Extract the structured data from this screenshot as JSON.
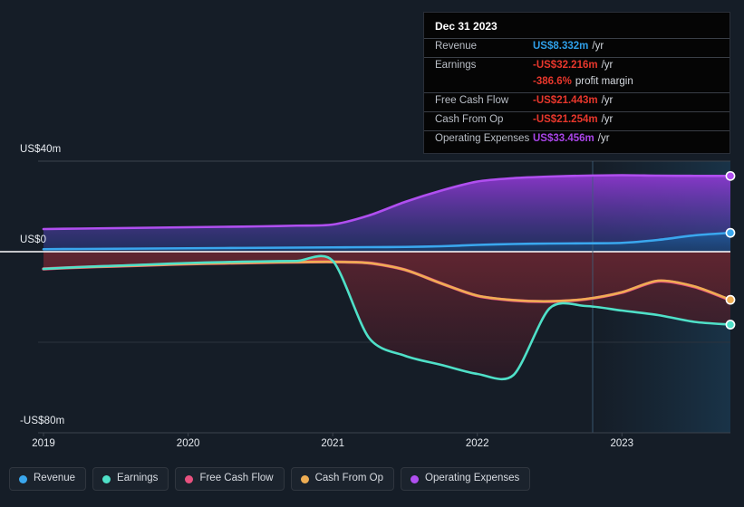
{
  "axes": {
    "y_labels": [
      "US$40m",
      "US$0",
      "-US$80m"
    ],
    "y_top_value": 40,
    "y_zero_value": 0,
    "y_bottom_value": -80,
    "x_labels": [
      "2019",
      "2020",
      "2021",
      "2022",
      "2023"
    ]
  },
  "tooltip": {
    "date": "Dec 31 2023",
    "rows": [
      {
        "label": "Revenue",
        "value": "US$8.332m",
        "unit": "/yr",
        "color_key": "blue"
      },
      {
        "label": "Earnings",
        "value": "-US$32.216m",
        "unit": "/yr",
        "color_key": "red"
      },
      {
        "label": "",
        "value": "-386.6%",
        "unit": "profit margin",
        "color_key": "red"
      },
      {
        "label": "Free Cash Flow",
        "value": "-US$21.443m",
        "unit": "/yr",
        "color_key": "red"
      },
      {
        "label": "Cash From Op",
        "value": "-US$21.254m",
        "unit": "/yr",
        "color_key": "red"
      },
      {
        "label": "Operating Expenses",
        "value": "US$33.456m",
        "unit": "/yr",
        "color_key": "purple"
      }
    ]
  },
  "legend": {
    "items": [
      {
        "label": "Revenue",
        "color": "#3aa7ee"
      },
      {
        "label": "Earnings",
        "color": "#4fe0c8"
      },
      {
        "label": "Free Cash Flow",
        "color": "#e8517f"
      },
      {
        "label": "Cash From Op",
        "color": "#eead53"
      },
      {
        "label": "Operating Expenses",
        "color": "#b04ff0"
      }
    ]
  },
  "colors": {
    "background": "#151d27",
    "zero_line": "#ffffff",
    "gridline": "#3c434d",
    "forecast_divider": "#3d5f7a",
    "positive_fill_top": "#b04ff0",
    "negative_fill": "#b33a3a"
  },
  "chart_data": {
    "type": "area",
    "title": "",
    "xlabel": "",
    "ylabel": "",
    "ylim": [
      -80,
      40
    ],
    "xlim": [
      "2019",
      "2023.75"
    ],
    "grid": true,
    "legend_position": "bottom",
    "annotation": "Vertical divider at 2023 separates reported from extrapolated period",
    "x": [
      2019.0,
      2019.25,
      2019.5,
      2019.75,
      2020.0,
      2020.25,
      2020.5,
      2020.75,
      2021.0,
      2021.25,
      2021.5,
      2021.75,
      2022.0,
      2022.25,
      2022.5,
      2022.75,
      2023.0,
      2023.25,
      2023.5,
      2023.75
    ],
    "series": [
      {
        "name": "Revenue",
        "color": "#3aa7ee",
        "values": [
          1.1,
          1.2,
          1.3,
          1.4,
          1.5,
          1.6,
          1.7,
          1.8,
          1.9,
          2.0,
          2.1,
          2.4,
          3.0,
          3.4,
          3.6,
          3.7,
          3.9,
          5.2,
          7.2,
          8.332
        ]
      },
      {
        "name": "Earnings",
        "color": "#4fe0c8",
        "values": [
          -7.6,
          -6.8,
          -6.2,
          -5.6,
          -5.0,
          -4.6,
          -4.3,
          -4.1,
          -4.0,
          -38.0,
          -46.0,
          -50.0,
          -54.0,
          -54.5,
          -25.0,
          -24.0,
          -26.0,
          -28.0,
          -31.0,
          -32.216
        ]
      },
      {
        "name": "Free Cash Flow",
        "color": "#e8517f",
        "values": [
          -7.6,
          -6.9,
          -6.4,
          -5.9,
          -5.4,
          -5.1,
          -4.8,
          -4.6,
          -4.5,
          -5.0,
          -8.0,
          -14.0,
          -19.5,
          -21.5,
          -22.0,
          -21.0,
          -18.0,
          -13.0,
          -15.5,
          -21.443
        ]
      },
      {
        "name": "Cash From Op",
        "color": "#eead53",
        "values": [
          -7.6,
          -6.9,
          -6.4,
          -5.9,
          -5.4,
          -5.1,
          -4.8,
          -4.6,
          -4.5,
          -5.0,
          -8.0,
          -14.0,
          -19.4,
          -21.4,
          -21.9,
          -20.9,
          -17.9,
          -12.8,
          -15.3,
          -21.254
        ]
      },
      {
        "name": "Operating Expenses",
        "color": "#b04ff0",
        "values": [
          10.0,
          10.2,
          10.4,
          10.6,
          10.8,
          11.0,
          11.2,
          11.5,
          12.0,
          16.0,
          22.0,
          27.0,
          31.0,
          32.5,
          33.2,
          33.6,
          33.8,
          33.6,
          33.5,
          33.456
        ]
      }
    ]
  }
}
